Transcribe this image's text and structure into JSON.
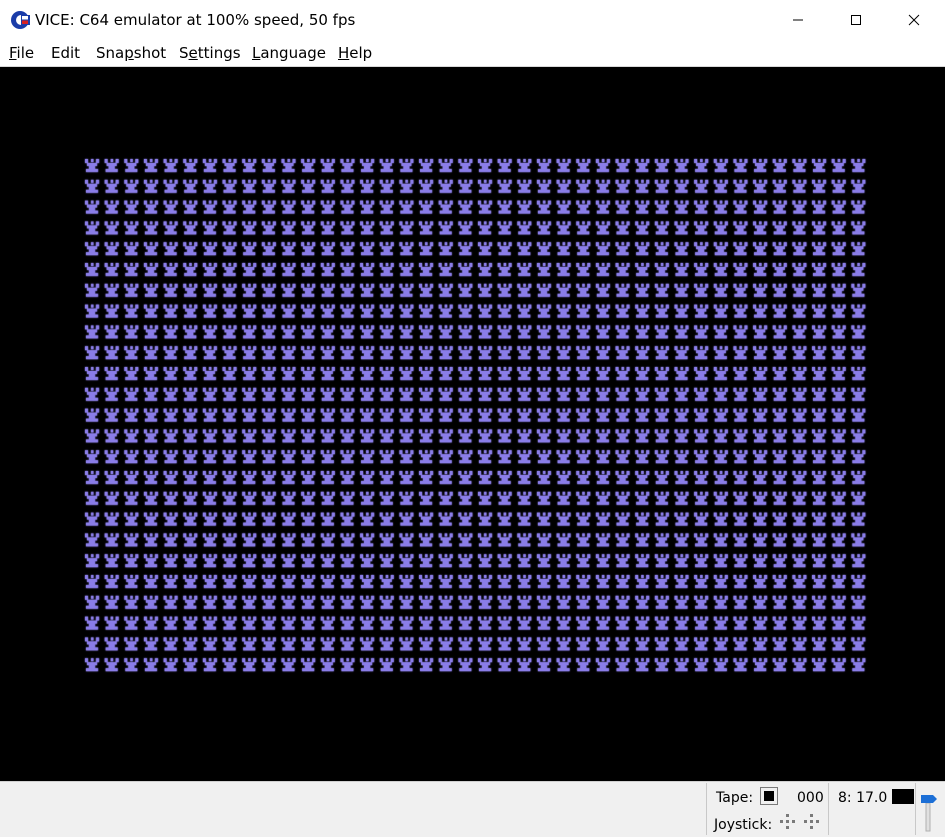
{
  "window": {
    "title": "VICE: C64 emulator at 100% speed, 50 fps",
    "icon": "commodore-logo-icon",
    "controls": [
      "minimize-icon",
      "maximize-icon",
      "close-icon"
    ]
  },
  "menu": {
    "items": [
      {
        "mnemonic": "F",
        "rest": "ile"
      },
      {
        "mnemonic": "",
        "rest": "Edit"
      },
      {
        "pre": "Sna",
        "mnemonic": "p",
        "rest": "shot"
      },
      {
        "pre": "S",
        "mnemonic": "e",
        "rest": "ttings"
      },
      {
        "mnemonic": "L",
        "rest": "anguage"
      },
      {
        "mnemonic": "H",
        "rest": "elp"
      }
    ]
  },
  "emulator_screen": {
    "border_color": "#000000",
    "glyph_color": "#8a7de8",
    "glyph_columns": 40,
    "glyph_rows": 25
  },
  "status": {
    "tape_label": "Tape:",
    "tape_counter": "000",
    "drive_label": "8: 17.0",
    "joystick_label": "Joystick:",
    "volume_icon": "volume-slider-icon"
  }
}
